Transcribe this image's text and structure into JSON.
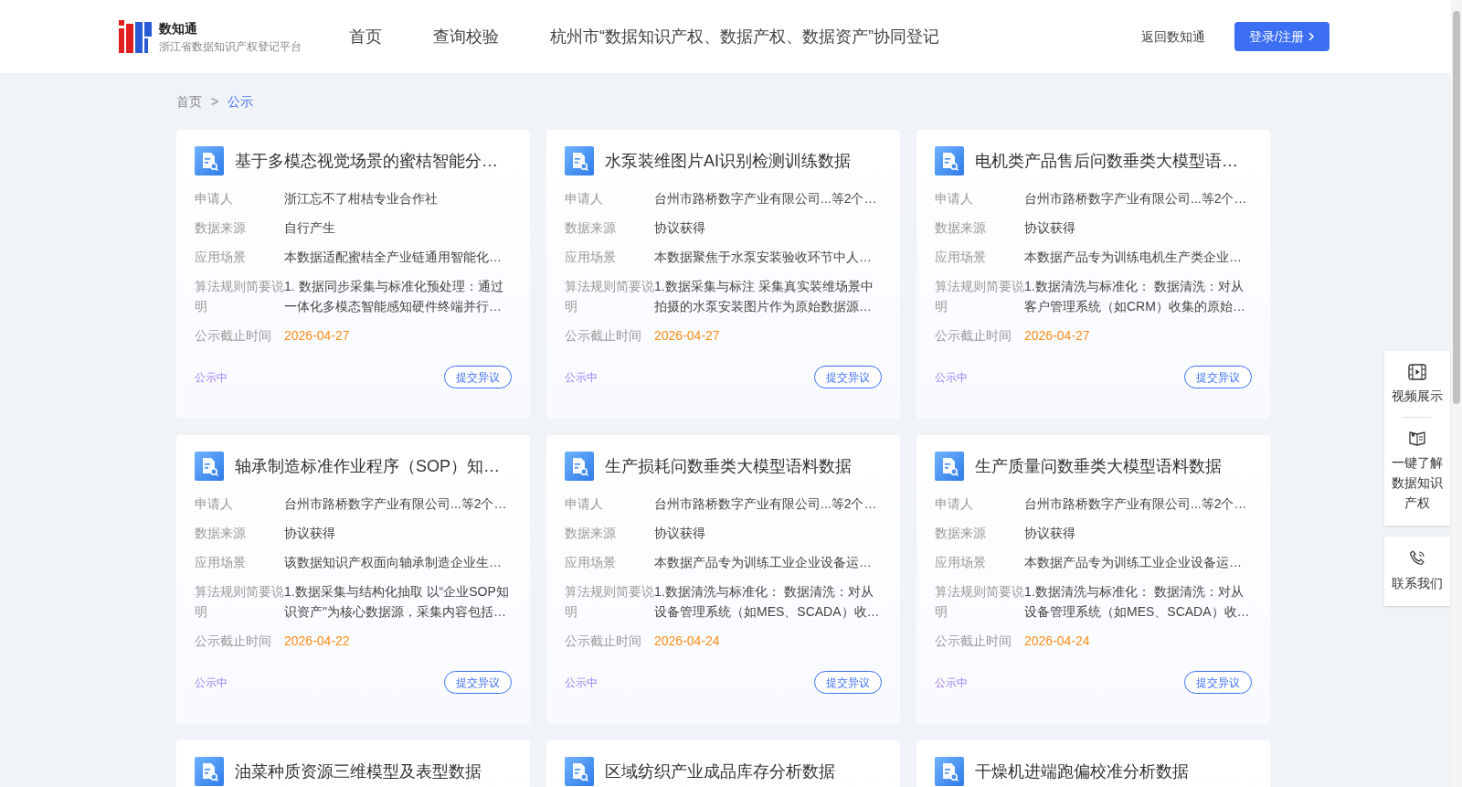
{
  "header": {
    "brand": "数知通",
    "subtitle": "浙江省数据知识产权登记平台",
    "nav": [
      {
        "label": "首页",
        "selected": false
      },
      {
        "label": "查询校验",
        "selected": false
      },
      {
        "label": "杭州市“数据知识产权、数据产权、数据资产”协同登记",
        "selected": false
      }
    ],
    "back_link": "返回数知通",
    "login_button": "登录/注册"
  },
  "breadcrumb": [
    {
      "label": "首页",
      "selected": false
    },
    {
      "label": "公示",
      "selected": true
    }
  ],
  "breadcrumb_separator": ">",
  "cards": [
    {
      "title": "基于多模态视觉场景的蜜桔智能分…",
      "rows": [
        {
          "kind": "text",
          "label": "申请人",
          "value": "浙江忘不了柑桔专业合作社"
        },
        {
          "kind": "text",
          "label": "数据来源",
          "value": "自行产生"
        },
        {
          "kind": "text",
          "label": "应用场景",
          "value": "本数据适配蜜桔全产业链通用智能化…"
        },
        {
          "kind": "text",
          "label": "算法规则简要说明",
          "value": "1. 数据同步采集与标准化预处理：通过一体化多模态智能感知硬件终端并行…"
        },
        {
          "kind": "date",
          "label": "公示截止时间",
          "value": "2026-04-27"
        }
      ],
      "status": "公示中",
      "button": "提交异议"
    },
    {
      "title": "水泵装维图片AI识别检测训练数据",
      "rows": [
        {
          "kind": "text",
          "label": "申请人",
          "value": "台州市路桥数字产业有限公司...等2个…"
        },
        {
          "kind": "text",
          "label": "数据来源",
          "value": "协议获得"
        },
        {
          "kind": "text",
          "label": "应用场景",
          "value": "本数据聚焦于水泵安装验收环节中人…"
        },
        {
          "kind": "text",
          "label": "算法规则简要说明",
          "value": "1.数据采集与标注 采集真实装维场景中拍摄的水泵安装图片作为原始数据源…"
        },
        {
          "kind": "date",
          "label": "公示截止时间",
          "value": "2026-04-27"
        }
      ],
      "status": "公示中",
      "button": "提交异议"
    },
    {
      "title": "电机类产品售后问数垂类大模型语…",
      "rows": [
        {
          "kind": "text",
          "label": "申请人",
          "value": "台州市路桥数字产业有限公司...等2个…"
        },
        {
          "kind": "text",
          "label": "数据来源",
          "value": "协议获得"
        },
        {
          "kind": "text",
          "label": "应用场景",
          "value": "本数据产品专为训练电机生产类企业…"
        },
        {
          "kind": "text",
          "label": "算法规则简要说明",
          "value": "1.数据清洗与标准化： 数据清洗：对从客户管理系统（如CRM）收集的原始…"
        },
        {
          "kind": "date",
          "label": "公示截止时间",
          "value": "2026-04-27"
        }
      ],
      "status": "公示中",
      "button": "提交异议"
    },
    {
      "title": "轴承制造标准作业程序（SOP）知…",
      "rows": [
        {
          "kind": "text",
          "label": "申请人",
          "value": "台州市路桥数字产业有限公司...等2个…"
        },
        {
          "kind": "text",
          "label": "数据来源",
          "value": "协议获得"
        },
        {
          "kind": "text",
          "label": "应用场景",
          "value": "该数据知识产权面向轴承制造企业生…"
        },
        {
          "kind": "text",
          "label": "算法规则简要说明",
          "value": "1.数据采集与结构化抽取 以“企业SOP知识资产\"为核心数据源，采集内容包括…"
        },
        {
          "kind": "date",
          "label": "公示截止时间",
          "value": "2026-04-22"
        }
      ],
      "status": "公示中",
      "button": "提交异议"
    },
    {
      "title": "生产损耗问数垂类大模型语料数据",
      "rows": [
        {
          "kind": "text",
          "label": "申请人",
          "value": "台州市路桥数字产业有限公司...等2个…"
        },
        {
          "kind": "text",
          "label": "数据来源",
          "value": "协议获得"
        },
        {
          "kind": "text",
          "label": "应用场景",
          "value": "本数据产品专为训练工业企业设备运…"
        },
        {
          "kind": "text",
          "label": "算法规则简要说明",
          "value": "1.数据清洗与标准化： 数据清洗：对从设备管理系统（如MES、SCADA）收…"
        },
        {
          "kind": "date",
          "label": "公示截止时间",
          "value": "2026-04-24"
        }
      ],
      "status": "公示中",
      "button": "提交异议"
    },
    {
      "title": "生产质量问数垂类大模型语料数据",
      "rows": [
        {
          "kind": "text",
          "label": "申请人",
          "value": "台州市路桥数字产业有限公司...等2个…"
        },
        {
          "kind": "text",
          "label": "数据来源",
          "value": "协议获得"
        },
        {
          "kind": "text",
          "label": "应用场景",
          "value": "本数据产品专为训练工业企业设备运…"
        },
        {
          "kind": "text",
          "label": "算法规则简要说明",
          "value": "1.数据清洗与标准化： 数据清洗：对从设备管理系统（如MES、SCADA）收…"
        },
        {
          "kind": "date",
          "label": "公示截止时间",
          "value": "2026-04-24"
        }
      ],
      "status": "公示中",
      "button": "提交异议"
    },
    {
      "title": "油菜种质资源三维模型及表型数据"
    },
    {
      "title": "区域纺织产业成品库存分析数据"
    },
    {
      "title": "干燥机进端跑偏校准分析数据"
    }
  ],
  "side_tools": [
    {
      "kind": "video",
      "label": "视频展示"
    },
    {
      "kind": "book",
      "label": "一键了解数据知识产权"
    },
    {
      "kind": "phone",
      "label": "联系我们"
    }
  ]
}
